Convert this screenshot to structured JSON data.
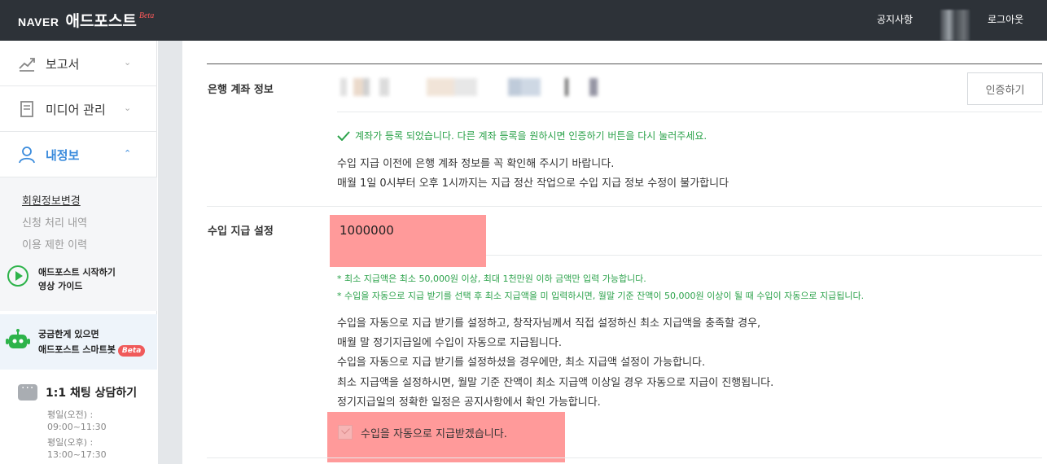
{
  "header": {
    "brand": "NAVER",
    "app_name": "애드포스트",
    "beta": "Beta",
    "notice": "공지사항",
    "logout": "로그아웃"
  },
  "sidebar": {
    "items": [
      {
        "label": "보고서",
        "icon": "chart-line-icon",
        "chevron": "⌄"
      },
      {
        "label": "미디어 관리",
        "icon": "document-icon",
        "chevron": "⌄"
      },
      {
        "label": "내정보",
        "icon": "user-icon",
        "chevron": "⌃"
      }
    ],
    "submenu": [
      {
        "label": "회원정보변경"
      },
      {
        "label": "신청 처리 내역"
      },
      {
        "label": "이용 제한 이력"
      }
    ],
    "guide": {
      "line1": "애드포스트 시작하기",
      "line2": "영상 가이드"
    },
    "bot": {
      "line1": "궁금한게 있으면",
      "line2": "애드포스트 스마트봇",
      "badge": "Beta"
    },
    "chat": {
      "title": "1:1 채팅 상담하기",
      "lines": [
        "평일(오전) :",
        "09:00~11:30",
        "평일(오후) :",
        "13:00~17:30"
      ]
    }
  },
  "bank": {
    "label": "은행 계좌 정보",
    "cert_button": "인증하기",
    "success": "계좌가 등록 되었습니다. 다른 계좌 등록을 원하시면 인증하기 버튼을 다시 눌러주세요.",
    "info1": "수입 지급 이전에 은행 계좌 정보를 꼭 확인해 주시기 바랍니다.",
    "info2": "매월 1일 0시부터 오후 1시까지는 지급 정산 작업으로 수입 지급 정보 수정이 불가합니다"
  },
  "payout": {
    "label": "수입 지급 설정",
    "amount": "1000000",
    "note1": "* 최소 지급액은 최소 50,000원 이상, 최대 1천만원 이하 금액만 입력 가능합니다.",
    "note2": "* 수입을 자동으로 지급 받기를 선택 후 최소 지급액을 미 입력하시면, 월말 기준 잔액이 50,000원 이상이 될 때 수입이 자동으로 지급됩니다.",
    "desc": [
      "수입을 자동으로 지급 받기를 설정하고, 창작자님께서 직접 설정하신 최소 지급액을 충족할 경우,",
      "매월 말 정기지급일에 수입이 자동으로 지급됩니다.",
      "수입을 자동으로 지급 받기를 설정하셨을 경우에만, 최소 지급액 설정이 가능합니다.",
      "최소 지급액을 설정하시면, 월말 기준 잔액이 최소 지급액 이상일 경우 자동으로 지급이 진행됩니다.",
      "정기지급일의 정확한 일정은 공지사항에서 확인 가능합니다."
    ],
    "auto_label": "수입을 자동으로 지급받겠습니다."
  }
}
